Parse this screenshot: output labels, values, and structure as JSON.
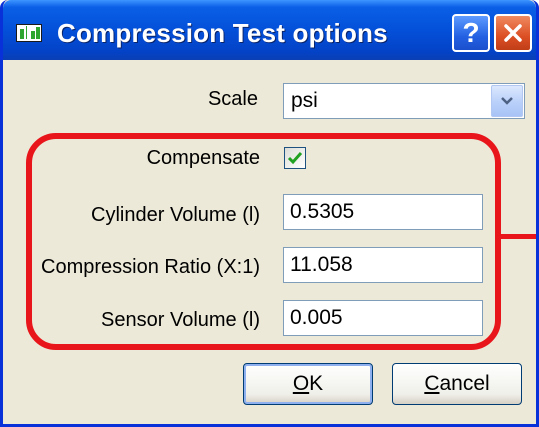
{
  "window": {
    "title": "Compression Test options",
    "help_label": "?"
  },
  "icons": {
    "app": "chart-bars-icon",
    "help": "help-icon",
    "close": "close-icon",
    "dropdown": "chevron-down-icon",
    "check": "checkmark-icon"
  },
  "form": {
    "scale_label": "Scale",
    "scale_value": "psi",
    "compensate_label": "Compensate",
    "compensate_checked": true,
    "cylinder_label": "Cylinder Volume (l)",
    "cylinder_value": "0.5305",
    "ratio_label": "Compression Ratio (X:1)",
    "ratio_value": "11.058",
    "sensor_label": "Sensor Volume (l)",
    "sensor_value": "0.005"
  },
  "buttons": {
    "ok_mnemonic": "O",
    "ok_rest": "K",
    "cancel_mnemonic": "C",
    "cancel_rest": "ancel"
  },
  "colors": {
    "titlebar": "#0450d9",
    "highlight": "#e8151b",
    "dialog_bg": "#ece9d8"
  }
}
